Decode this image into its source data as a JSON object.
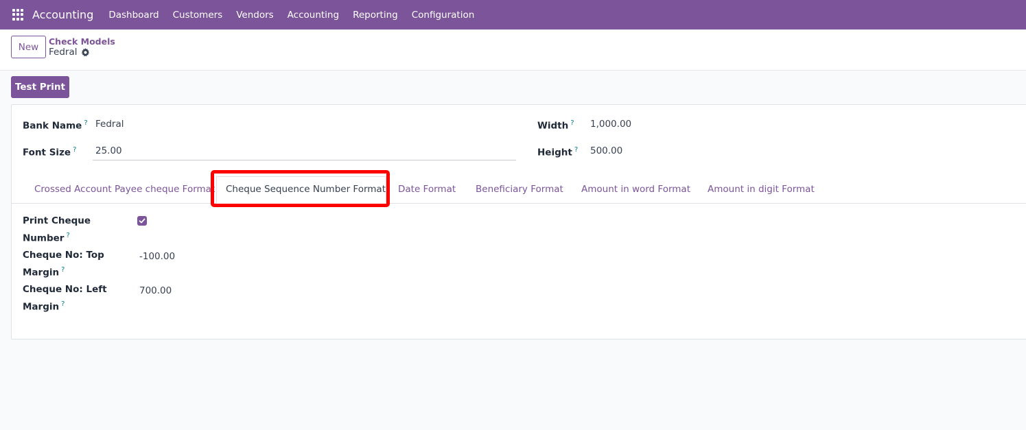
{
  "navbar": {
    "app_name": "Accounting",
    "menu": [
      "Dashboard",
      "Customers",
      "Vendors",
      "Accounting",
      "Reporting",
      "Configuration"
    ]
  },
  "control_panel": {
    "new_label": "New",
    "breadcrumb": "Check Models",
    "record_name": "Fedral"
  },
  "actions": {
    "test_print_label": "Test Print"
  },
  "form": {
    "bank_name_label": "Bank Name",
    "bank_name_value": "Fedral",
    "font_size_label": "Font Size",
    "font_size_value": "25.00",
    "width_label": "Width",
    "width_value": "1,000.00",
    "height_label": "Height",
    "height_value": "500.00",
    "help_mark": "?"
  },
  "tabs": [
    {
      "label": "Crossed Account Payee cheque Format",
      "active": false
    },
    {
      "label": "Cheque Sequence Number Format",
      "active": true
    },
    {
      "label": "Date Format",
      "active": false
    },
    {
      "label": "Beneficiary Format",
      "active": false
    },
    {
      "label": "Amount in word Format",
      "active": false
    },
    {
      "label": "Amount in digit Format",
      "active": false
    }
  ],
  "tab_content": {
    "print_cheque_number_label_1": "Print Cheque",
    "print_cheque_number_label_2": "Number",
    "print_cheque_number_checked": true,
    "top_margin_label_1": "Cheque No: Top",
    "top_margin_label_2": "Margin",
    "top_margin_value": "-100.00",
    "left_margin_label_1": "Cheque No: Left",
    "left_margin_label_2": "Margin",
    "left_margin_value": "700.00"
  },
  "colors": {
    "brand": "#7c5499",
    "highlight": "#ff0000",
    "help": "#017e84"
  }
}
